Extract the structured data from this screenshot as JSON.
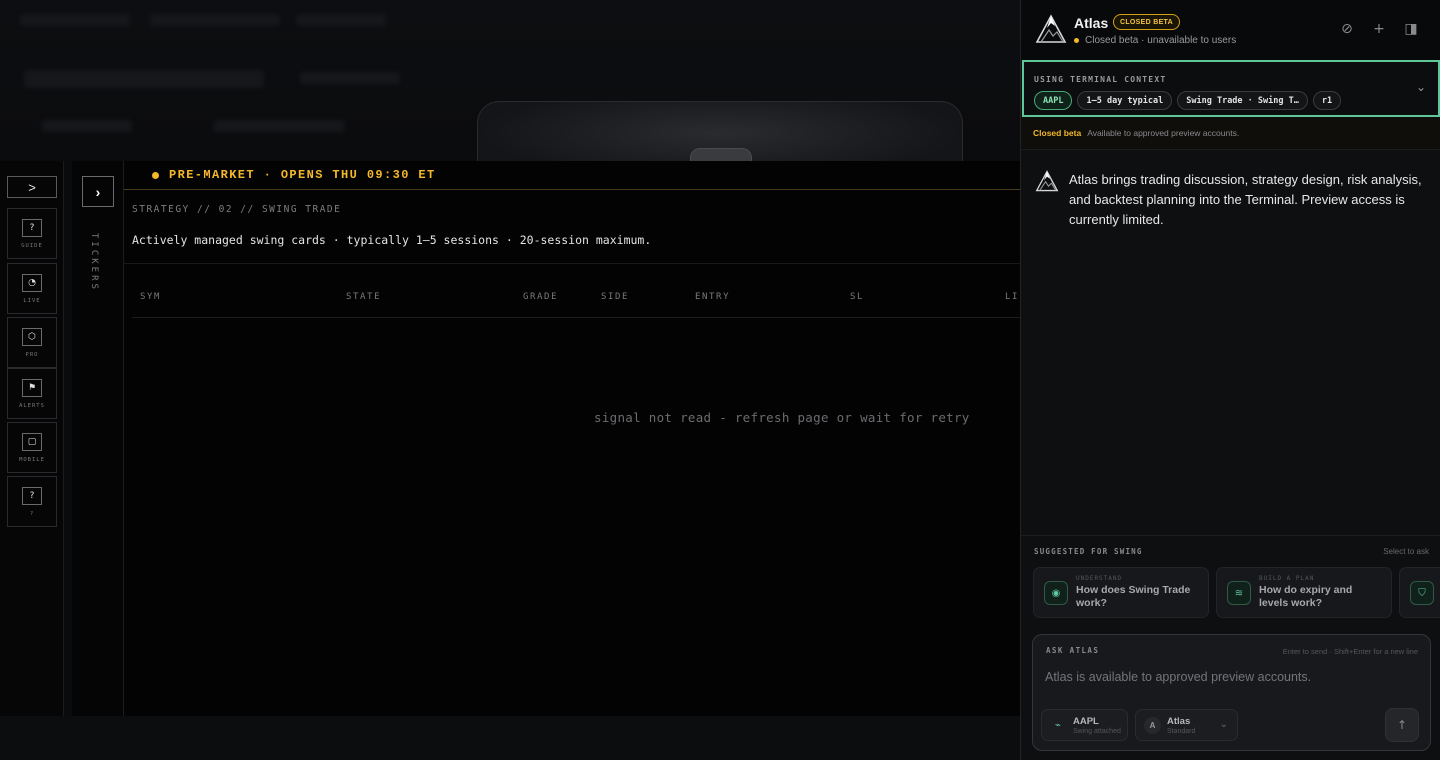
{
  "market_bar": {
    "text": "PRE-MARKET · OPENS THU 09:30 ET"
  },
  "rail": {
    "toggle_glyph": ">",
    "items": [
      {
        "label": "GUIDE",
        "glyph": "?",
        "icon": "guide-icon"
      },
      {
        "label": "LIVE",
        "glyph": "◔",
        "icon": "live-icon"
      },
      {
        "label": "PRO",
        "glyph": "⬡",
        "icon": "pro-icon"
      },
      {
        "label": "ALERTS",
        "glyph": "⚑",
        "icon": "alerts-icon"
      },
      {
        "label": "MOBILE",
        "glyph": "▢",
        "icon": "mobile-icon"
      },
      {
        "label": "?",
        "glyph": "?",
        "icon": "help-icon"
      }
    ]
  },
  "tickers": {
    "label": "TICKERS",
    "toggle_glyph": "›"
  },
  "strategy": {
    "heading": "STRATEGY // 02 // SWING TRADE",
    "description": "Actively managed swing cards · typically 1–5 sessions · 20-session maximum.",
    "columns": [
      "SYM",
      "STATE",
      "GRADE",
      "SIDE",
      "ENTRY",
      "SL",
      "LI"
    ],
    "empty_message": "signal not read - refresh page or wait for retry"
  },
  "atlas": {
    "name": "Atlas",
    "badge": "CLOSED BETA",
    "status": "Closed beta · unavailable to users",
    "header_icons": [
      "edit-icon",
      "plus-icon",
      "panel-icon"
    ],
    "context": {
      "label": "USING TERMINAL CONTEXT",
      "chips": [
        "AAPL",
        "1–5 day typical",
        "Swing Trade · Swing T…",
        "r1"
      ]
    },
    "beta_note": {
      "title": "Closed beta",
      "text": "Available to approved preview accounts."
    },
    "message": "Atlas brings trading discussion, strategy design, risk analysis, and backtest planning into the Terminal. Preview access is currently limited.",
    "suggestions": {
      "title": "SUGGESTED FOR SWING",
      "hint": "Select to ask",
      "cards": [
        {
          "kicker": "UNDERSTAND",
          "question": "How does Swing Trade work?",
          "icon": "eye-icon",
          "glyph": "◉"
        },
        {
          "kicker": "BUILD A PLAN",
          "question": "How do expiry and levels work?",
          "icon": "layers-icon",
          "glyph": "≋"
        },
        {
          "kicker": "",
          "question": "",
          "icon": "shield-icon",
          "glyph": "⛉"
        }
      ]
    },
    "ask": {
      "label": "ASK ATLAS",
      "hint": "Enter to send · Shift+Enter for a new line",
      "placeholder": "Atlas is available to approved preview accounts.",
      "context_chip": {
        "title": "AAPL",
        "subtitle": "Swing attached"
      },
      "model_chip": {
        "avatar": "A",
        "title": "Atlas",
        "subtitle": "Standard"
      }
    }
  },
  "colors": {
    "accent_amber": "#f5b82a",
    "accent_green": "#5fc79a"
  }
}
